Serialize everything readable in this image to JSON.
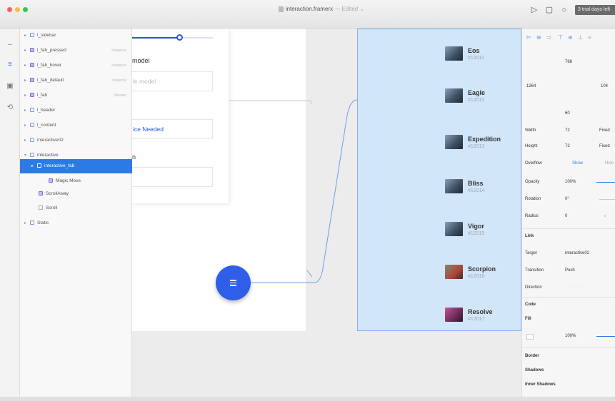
{
  "window": {
    "title": "interaction.framerx",
    "edited": "— Edited ⌄",
    "trial_label": "3 trial days left"
  },
  "layers": [
    {
      "label": "l_sidebar",
      "icon": "blue",
      "badge": ""
    },
    {
      "label": "l_fab_pressed",
      "icon": "purple",
      "badge": "Instance"
    },
    {
      "label": "l_fab_hover",
      "icon": "purple",
      "badge": "Instance"
    },
    {
      "label": "l_fab_default",
      "icon": "purple",
      "badge": "Instance"
    },
    {
      "label": "l_fab",
      "icon": "purple",
      "badge": "Master"
    },
    {
      "label": "l_header",
      "icon": "blue",
      "badge": ""
    },
    {
      "label": "l_content",
      "icon": "blue",
      "badge": ""
    },
    {
      "label": "interactive02",
      "icon": "blue",
      "badge": ""
    },
    {
      "label": "interactive",
      "icon": "blue",
      "badge": ""
    },
    {
      "label": "interactive_fab",
      "icon": "blue",
      "badge": ""
    },
    {
      "label": "Magic Move",
      "icon": "purple",
      "badge": ""
    },
    {
      "label": "ScrollAway",
      "icon": "purple",
      "badge": ""
    },
    {
      "label": "Scroll",
      "icon": "gray",
      "badge": ""
    },
    {
      "label": "Static",
      "icon": "blue",
      "badge": ""
    }
  ],
  "form": {
    "label1": "model",
    "field1": "le model",
    "field2": "ice Needed",
    "label3": "n"
  },
  "list_items": [
    {
      "name": "Eos",
      "id": "#12011"
    },
    {
      "name": "Eagle",
      "id": "#12012"
    },
    {
      "name": "Expedition",
      "id": "#12013"
    },
    {
      "name": "Bliss",
      "id": "#12014"
    },
    {
      "name": "Vigor",
      "id": "#12015"
    },
    {
      "name": "Scorpion",
      "id": "#12016"
    },
    {
      "name": "Resolve",
      "id": "#12017"
    }
  ],
  "props": {
    "top_val": "768",
    "left_val": "1264",
    "right_val": "104",
    "bottom_val": "60",
    "width_label": "Width",
    "width_val": "72",
    "width_mode": "Fixed",
    "height_label": "Height",
    "height_val": "72",
    "height_mode": "Fixed",
    "overflow_label": "Overflow",
    "overflow_show": "Show",
    "overflow_hide": "Hide",
    "opacity_label": "Opacity",
    "opacity_val": "100%",
    "rotation_label": "Rotation",
    "rotation_val": "0°",
    "radius_label": "Radius",
    "radius_val": "0",
    "link_label": "Link",
    "target_label": "Target",
    "target_val": "interactive02",
    "transition_label": "Transition",
    "transition_val": "Push",
    "direction_label": "Direction",
    "code_label": "Code",
    "fill_label": "Fill",
    "fill_opacity": "100%",
    "border_label": "Border",
    "shadows_label": "Shadows",
    "inner_shadows_label": "Inner Shadows"
  },
  "colors": {
    "accent": "#2c7be5",
    "fab": "#2f5ee8",
    "artboard_selected": "#d2e6f9"
  }
}
